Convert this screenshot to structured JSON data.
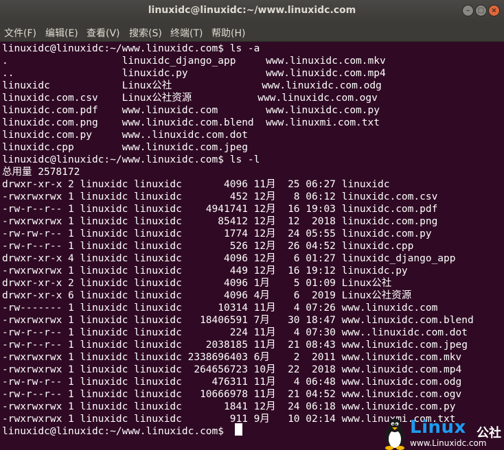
{
  "window": {
    "title": "linuxidc@linuxidc:~/www.linuxidc.com",
    "minimize_label": "–",
    "maximize_label": "□",
    "close_label": "×"
  },
  "menu": [
    "文件(F)",
    "编辑(E)",
    "查看(V)",
    "搜索(S)",
    "终端(T)",
    "帮助(H)"
  ],
  "terminal": {
    "lines": [
      "linuxidc@linuxidc:~/www.linuxidc.com$ ls -a",
      ".                   linuxidc_django_app     www.linuxidc.com.mkv",
      "..                  linuxidc.py             www.linuxidc.com.mp4",
      "linuxidc            Linux公社               www.linuxidc.com.odg",
      "linuxidc.com.csv    Linux公社资源           www.linuxidc.com.ogv",
      "linuxidc.com.pdf    www.linuxidc.com        www.linuxidc.com.py",
      "linuxidc.com.png    www.linuxidc.com.blend  www.linuxmi.com.txt",
      "linuxidc.com.py     www..linuxidc.com.dot",
      "linuxidc.cpp        www.linuxidc.com.jpeg",
      "linuxidc@linuxidc:~/www.linuxidc.com$ ls -l",
      "总用量 2578172",
      "drwxr-xr-x 2 linuxidc linuxidc       4096 11月  25 06:27 linuxidc",
      "-rwxrwxrwx 1 linuxidc linuxidc        452 12月   8 06:12 linuxidc.com.csv",
      "-rw-r--r-- 1 linuxidc linuxidc    4941741 12月  16 19:03 linuxidc.com.pdf",
      "-rwxrwxrwx 1 linuxidc linuxidc      85412 12月  12  2018 linuxidc.com.png",
      "-rw-rw-r-- 1 linuxidc linuxidc       1774 12月  24 05:55 linuxidc.com.py",
      "-rw-r--r-- 1 linuxidc linuxidc        526 12月  26 04:52 linuxidc.cpp",
      "drwxr-xr-x 4 linuxidc linuxidc       4096 12月   6 01:27 linuxidc_django_app",
      "-rwxrwxrwx 1 linuxidc linuxidc        449 12月  16 19:12 linuxidc.py",
      "drwxr-xr-x 2 linuxidc linuxidc       4096 1月    5 01:09 Linux公社",
      "drwxr-xr-x 6 linuxidc linuxidc       4096 4月    6  2019 Linux公社资源",
      "-rw------- 1 linuxidc linuxidc      10314 11月   4 07:26 www.linuxidc.com",
      "-rwxrwxrwx 1 linuxidc linuxidc   18406591 7月   30 18:47 www.linuxidc.com.blend",
      "-rw-r--r-- 1 linuxidc linuxidc        224 11月   4 07:30 www..linuxidc.com.dot",
      "-rw-r--r-- 1 linuxidc linuxidc    2038185 11月  21 08:43 www.linuxidc.com.jpeg",
      "-rwxrwxrwx 1 linuxidc linuxidc 2338696403 6月    2  2011 www.linuxidc.com.mkv",
      "-rwxrwxrwx 1 linuxidc linuxidc  264656723 10月  22  2018 www.linuxidc.com.mp4",
      "-rw-rw-r-- 1 linuxidc linuxidc     476311 11月   4 06:48 www.linuxidc.com.odg",
      "-rw-r--r-- 1 linuxidc linuxidc   10666978 11月  21 04:52 www.linuxidc.com.ogv",
      "-rwxrwxrwx 1 linuxidc linuxidc       1841 12月  24 06:18 www.linuxidc.com.py",
      "-rwxrwxrwx 1 linuxidc linuxidc        911 9月   10 02:14 www.linuxmi.com.txt",
      "linuxidc@linuxidc:~/www.linuxidc.com$ "
    ]
  },
  "watermark": {
    "brand": "Linux",
    "brand_cn": "公社",
    "url": "www.Linuxidc.com",
    "brand_color": "#1c9cf0"
  },
  "colors": {
    "terminal_bg": "#300a24",
    "titlebar_bg": "#3c3b37",
    "close_button": "#e0673a"
  }
}
